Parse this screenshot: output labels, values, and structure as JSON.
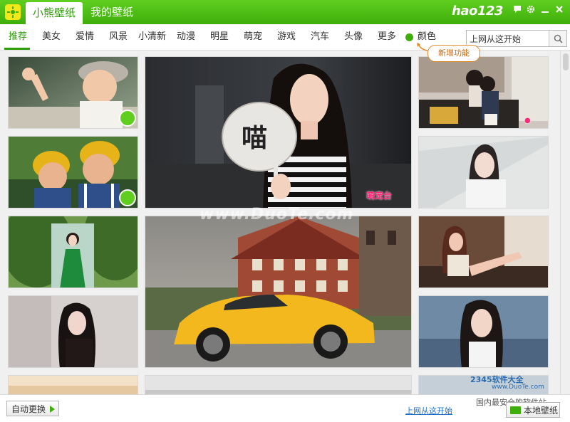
{
  "app": {
    "tabs": [
      {
        "label": "小熊壁纸",
        "active": true
      },
      {
        "label": "我的壁纸",
        "active": false
      }
    ],
    "brand": "hao123",
    "accent_color": "#3fae0b"
  },
  "window_controls": [
    "feedback-icon",
    "gear-icon",
    "minimize-icon",
    "close-icon"
  ],
  "nav": {
    "items": [
      "推荐",
      "美女",
      "爱情",
      "风景",
      "小清新",
      "动漫",
      "明星",
      "萌宠",
      "游戏",
      "汽车",
      "头像",
      "更多",
      "颜色"
    ],
    "active_index": 0,
    "new_feature_tooltip": "新增功能"
  },
  "search": {
    "value": "上网从这开始",
    "icon": "search-icon"
  },
  "wallpapers": {
    "fan_text": "喵",
    "watermark": "www.DuoTe.com",
    "logo": "萌宠台"
  },
  "footer": {
    "auto_change_label": "自动更换",
    "link_label": "上网从这开始",
    "watermark_site": "2345软件大全",
    "watermark_url": "www.DuoTe.com",
    "watermark_slogan": "国内最安全的软件站",
    "local_label": "本地壁纸"
  }
}
